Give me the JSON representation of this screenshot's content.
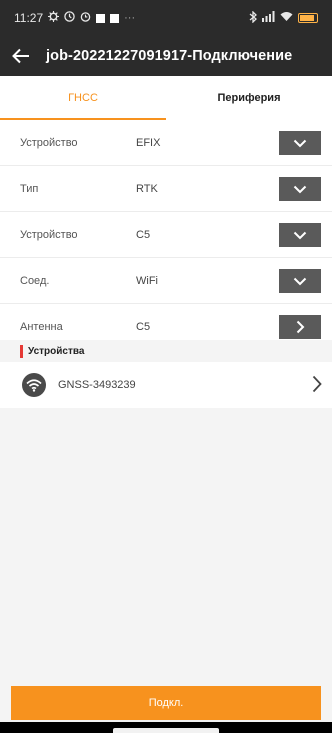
{
  "status_bar": {
    "time": "11:27",
    "icons": [
      "settings-sync-icon",
      "clock-icon",
      "alarm-icon",
      "square-icon",
      "square-icon",
      "more-dots-icon",
      "bluetooth-icon",
      "signal-icon",
      "wifi-icon",
      "battery-icon"
    ],
    "more": "···"
  },
  "header": {
    "title": "job-20221227091917-Подключение"
  },
  "tabs": [
    {
      "label": "ГНСС",
      "active": true
    },
    {
      "label": "Периферия",
      "active": false
    }
  ],
  "settings": {
    "rows": [
      {
        "label": "Устройство",
        "value": "EFIX",
        "action": "dropdown"
      },
      {
        "label": "Тип",
        "value": "RTK",
        "action": "dropdown"
      },
      {
        "label": "Устройство",
        "value": "C5",
        "action": "dropdown"
      },
      {
        "label": "Соед.",
        "value": "WiFi",
        "action": "dropdown"
      },
      {
        "label": "Антенна",
        "value": "C5",
        "action": "navigate"
      }
    ]
  },
  "devices_section": {
    "title": "Устройства",
    "items": [
      {
        "name": "GNSS-3493239",
        "icon": "wifi-icon"
      }
    ]
  },
  "submit": {
    "label": "Подкл."
  },
  "colors": {
    "accent": "#f7921e",
    "header_bg": "#2b2b2b",
    "button_dark": "#5a5a5a",
    "section_marker": "#e53935"
  }
}
